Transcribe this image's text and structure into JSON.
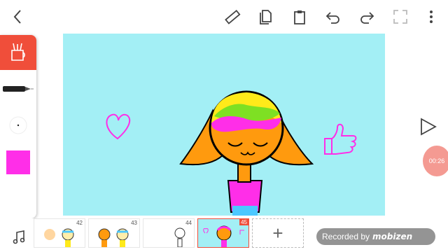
{
  "toolbar": {
    "icons": [
      "back-icon",
      "ruler-icon",
      "copy-icon",
      "paste-icon",
      "undo-icon",
      "redo-icon",
      "fullscreen-icon",
      "more-icon"
    ]
  },
  "sidebar": {
    "active_tool": "pen-cup-icon",
    "brush": "brush-icon",
    "brush_size": "dot-icon",
    "color": "#ff2ee8"
  },
  "timeline": {
    "frames": [
      {
        "num": "42"
      },
      {
        "num": "43"
      },
      {
        "num": "44"
      },
      {
        "num": "45",
        "selected": true
      }
    ],
    "add_label": "+"
  },
  "recording_badge": {
    "text": "00:26"
  },
  "watermark": {
    "recorded_by": "Recorded by",
    "brand": "mobizen"
  },
  "colors": {
    "accent": "#f04e3a",
    "canvas": "#a3eff5",
    "pink": "#ff2ee8",
    "orange": "#ff9a0e"
  }
}
